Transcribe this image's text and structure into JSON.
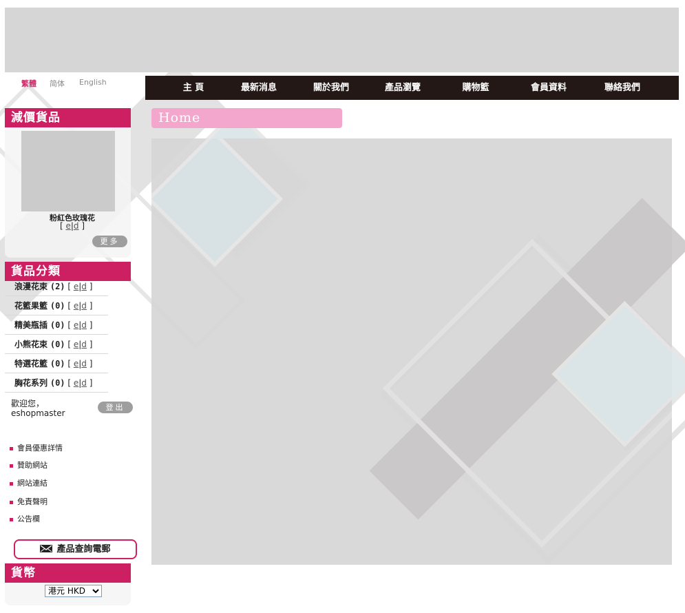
{
  "languages": [
    {
      "label": "繁體",
      "active": true
    },
    {
      "label": "简体",
      "active": false
    },
    {
      "label": "English",
      "active": false
    }
  ],
  "nav": {
    "items": [
      "主 頁",
      "最新消息",
      "關於我們",
      "產品瀏覽",
      "購物籃",
      "會員資料",
      "聯絡我們"
    ]
  },
  "promo": {
    "title": "減價貨品",
    "product_name": "粉紅色玫瑰花",
    "edit_e": "e",
    "edit_d": "d",
    "more_label": "更多"
  },
  "categories": {
    "title": "貨品分類",
    "items": [
      {
        "name": "浪漫花束",
        "count": "(2)"
      },
      {
        "name": "花籃果籃",
        "count": "(0)"
      },
      {
        "name": "精美瓶插",
        "count": "(0)"
      },
      {
        "name": "小熊花束",
        "count": "(0)"
      },
      {
        "name": "特選花籃",
        "count": "(0)"
      },
      {
        "name": "胸花系列",
        "count": "(0)"
      }
    ],
    "edit_e": "e",
    "edit_d": "d"
  },
  "user": {
    "welcome": "歡迎您，",
    "username": "eshopmaster",
    "logout_label": "登出"
  },
  "info_links": [
    "會員優惠詳情",
    "贊助網站",
    "網站連結",
    "免責聲明",
    "公告欄"
  ],
  "enquiry_button": "產品查詢電郵",
  "currency": {
    "title": "貨幣",
    "selected": "港元 HKD"
  },
  "page": {
    "title": "Home"
  },
  "colors": {
    "accent": "#cc2063",
    "nav_bg": "#231815",
    "title_bar": "#f3a7cd"
  }
}
